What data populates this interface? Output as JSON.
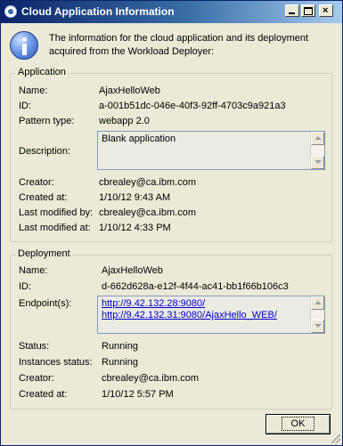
{
  "window": {
    "title": "Cloud Application Information",
    "close_glyph": "×"
  },
  "intro_text": "The information for the cloud application and its deployment acquired from the Workload Deployer:",
  "application": {
    "legend": "Application",
    "name_label": "Name:",
    "name_value": "AjaxHelloWeb",
    "id_label": "ID:",
    "id_value": "a-001b51dc-046e-40f3-92ff-4703c9a921a3",
    "pattern_label": "Pattern type:",
    "pattern_value": "webapp 2.0",
    "description_label": "Description:",
    "description_value": "Blank application",
    "creator_label": "Creator:",
    "creator_value": "cbrealey@ca.ibm.com",
    "created_label": "Created at:",
    "created_value": "1/10/12 9:43 AM",
    "modified_by_label": "Last modified by:",
    "modified_by_value": "cbrealey@ca.ibm.com",
    "modified_at_label": "Last modified at:",
    "modified_at_value": "1/10/12 4:33 PM"
  },
  "deployment": {
    "legend": "Deployment",
    "name_label": "Name:",
    "name_value": "AjaxHelloWeb",
    "id_label": "ID:",
    "id_value": "d-662d628a-e12f-4f44-ac41-bb1f66b106c3",
    "endpoints_label": "Endpoint(s):",
    "endpoints": [
      "http://9.42.132.28:9080/",
      "http://9.42.132.31:9080/AjaxHello_WEB/"
    ],
    "status_label": "Status:",
    "status_value": "Running",
    "instances_label": "Instances status:",
    "instances_value": "Running",
    "creator_label": "Creator:",
    "creator_value": "cbrealey@ca.ibm.com",
    "created_label": "Created at:",
    "created_value": "1/10/12 5:57 PM"
  },
  "buttons": {
    "ok_label": "OK"
  },
  "icons": {
    "title": "app-globe-icon",
    "info": "info-icon",
    "minimize": "minimize-icon",
    "maximize": "maximize-icon",
    "close": "close-icon"
  }
}
